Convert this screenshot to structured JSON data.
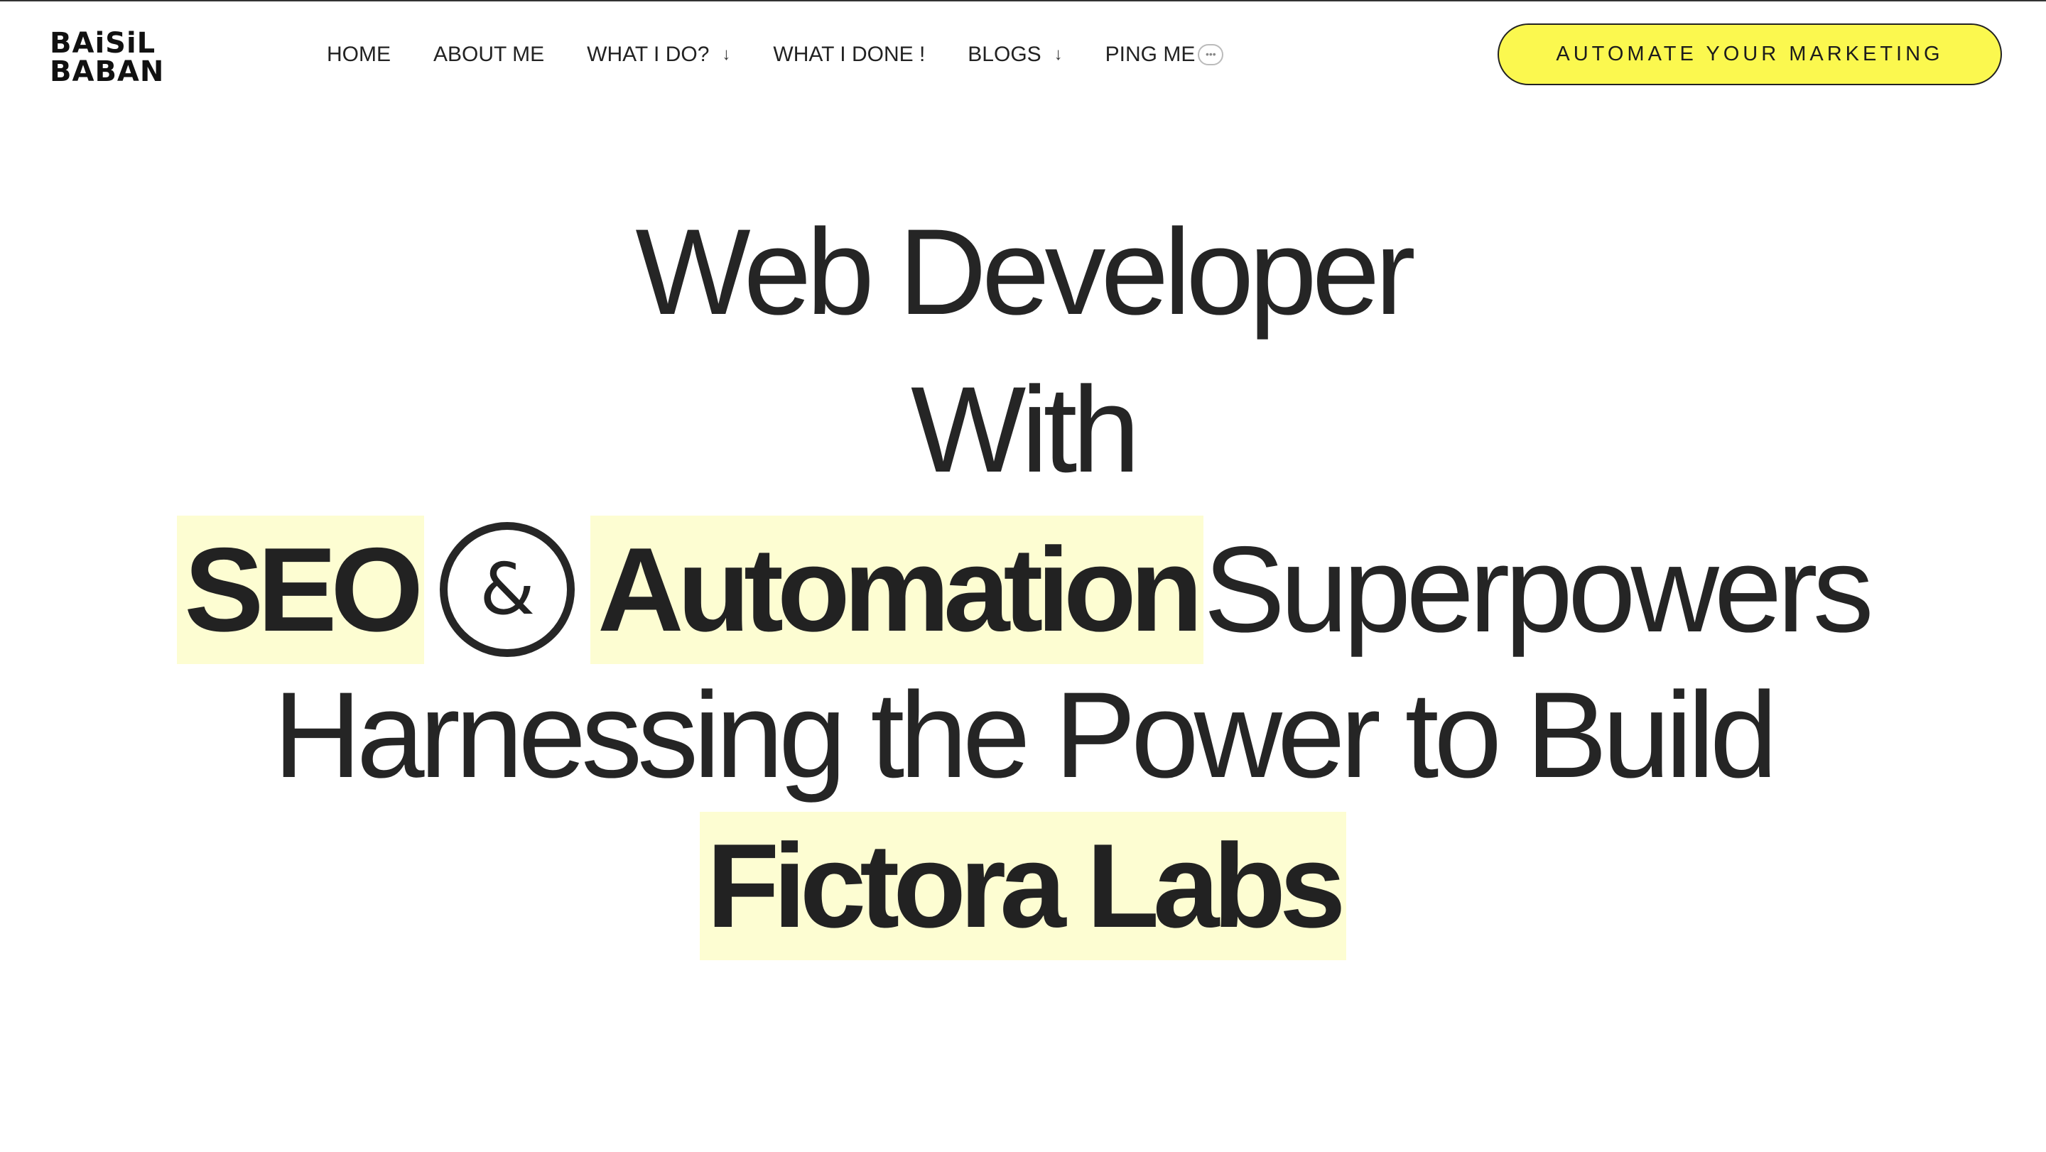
{
  "logo": {
    "line1": "BAiSiL",
    "line2": "BABAN"
  },
  "nav": {
    "items": [
      {
        "label": "HOME"
      },
      {
        "label": "ABOUT ME"
      },
      {
        "label": "WHAT I DO?",
        "chevron": "↓"
      },
      {
        "label": "WHAT I DONE !"
      },
      {
        "label": "BLOGS",
        "chevron": "↓"
      },
      {
        "label": "PING ME",
        "icon": "chat-bubble-icon"
      }
    ]
  },
  "cta": {
    "label": "AUTOMATE YOUR MARKETING",
    "color": "#fbf84f"
  },
  "hero": {
    "line1": "Web Developer",
    "line2": "With",
    "seo": "SEO",
    "amp": "&",
    "automation": "Automation",
    "superpowers": "Superpowers",
    "line4": "Harnessing the Power to Build",
    "brand": "Fictora Labs",
    "highlight_color": "#fdfdd2"
  }
}
